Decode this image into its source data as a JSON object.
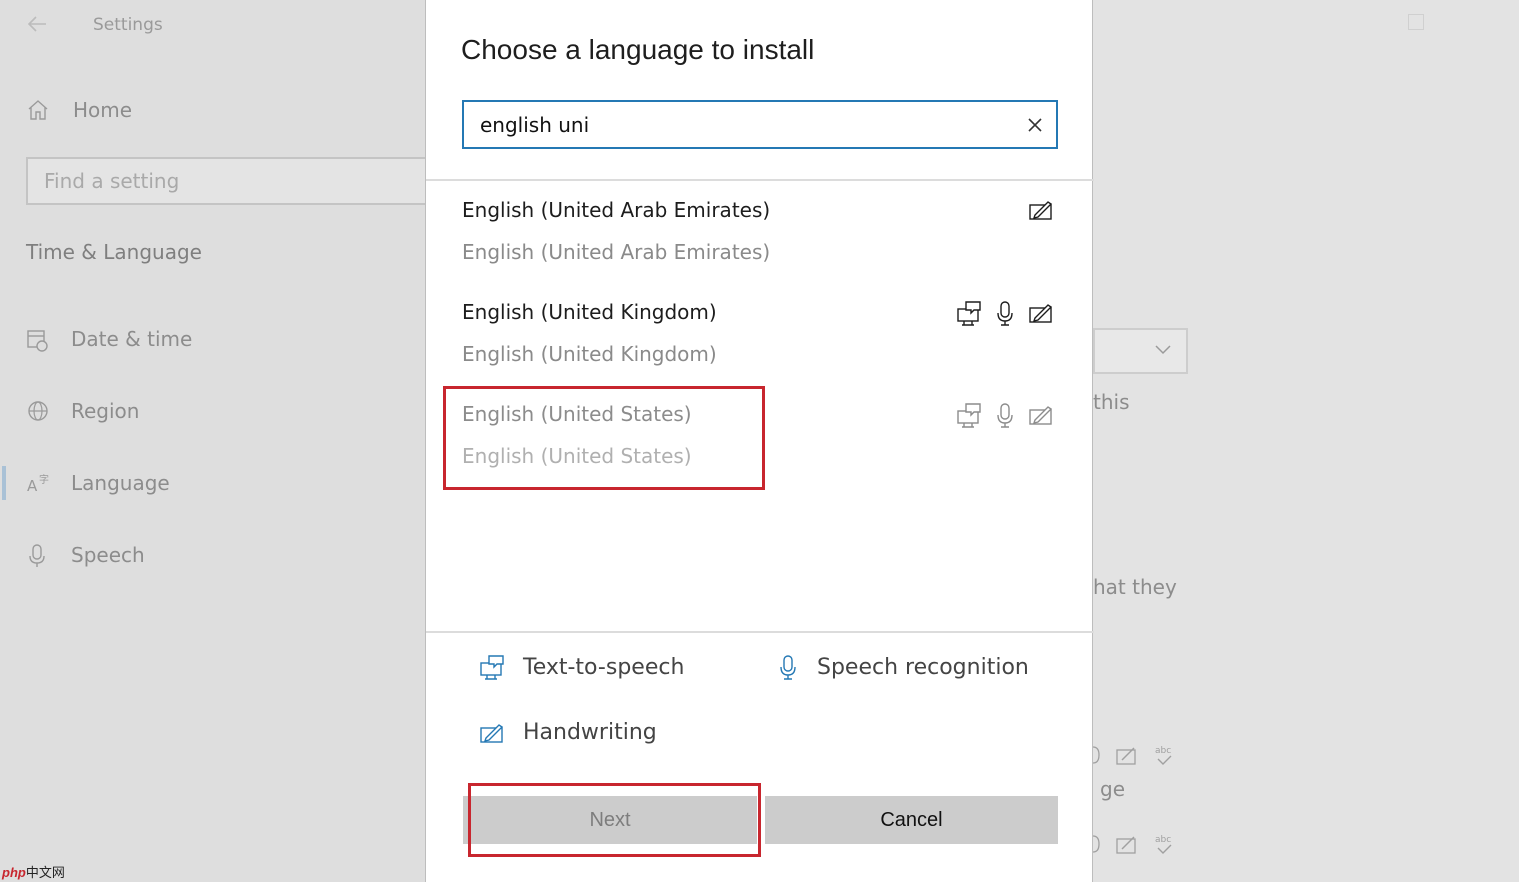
{
  "settings": {
    "title": "Settings",
    "home_label": "Home",
    "search_placeholder": "Find a setting",
    "section_title": "Time & Language",
    "nav": [
      {
        "label": "Date & time",
        "icon": "calendar-clock-icon"
      },
      {
        "label": "Region",
        "icon": "globe-icon"
      },
      {
        "label": "Language",
        "icon": "language-icon"
      },
      {
        "label": "Speech",
        "icon": "microphone-icon"
      }
    ],
    "right_fragments": [
      "this",
      "hat they",
      "ge"
    ]
  },
  "dialog": {
    "title": "Choose a language to install",
    "search_value": "english uni",
    "languages": [
      {
        "name": "English (United Arab Emirates)",
        "native": "English (United Arab Emirates)",
        "features": [
          "handwriting-icon"
        ]
      },
      {
        "name": "English (United Kingdom)",
        "native": "English (United Kingdom)",
        "features": [
          "text-to-speech-icon",
          "speech-recognition-icon",
          "handwriting-icon"
        ]
      },
      {
        "name": "English (United States)",
        "native": "English (United States)",
        "features": [
          "text-to-speech-icon",
          "speech-recognition-icon",
          "handwriting-icon"
        ]
      }
    ],
    "legend": {
      "tts": "Text-to-speech",
      "speech": "Speech recognition",
      "handwriting": "Handwriting"
    },
    "next_label": "Next",
    "cancel_label": "Cancel"
  },
  "watermark": {
    "php": "php",
    "cn": "中文网"
  },
  "colors": {
    "accent": "#2478b4",
    "highlight": "#c8262e"
  }
}
